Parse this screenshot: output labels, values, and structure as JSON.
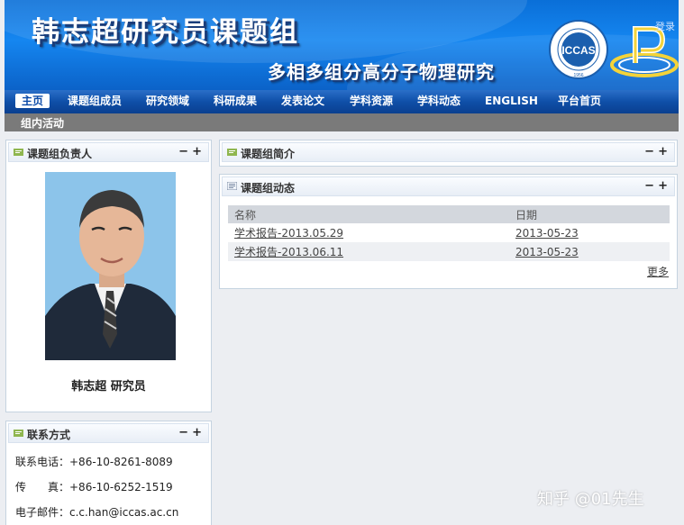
{
  "banner": {
    "title": "韩志超研究员课题组",
    "subtitle": "多相多组分高分子物理研究",
    "login": "登录",
    "seal_text": "ICCAS",
    "seal_year": "1956"
  },
  "nav": {
    "items": [
      {
        "label": "主页",
        "active": true
      },
      {
        "label": "课题组成员"
      },
      {
        "label": "研究领域"
      },
      {
        "label": "科研成果"
      },
      {
        "label": "发表论文"
      },
      {
        "label": "学科资源"
      },
      {
        "label": "学科动态"
      },
      {
        "label": "ENGLISH"
      },
      {
        "label": "平台首页"
      }
    ],
    "second_row": "组内活动"
  },
  "leader_panel": {
    "title": "课题组负责人",
    "name": "韩志超  研究员"
  },
  "contact_panel": {
    "title": "联系方式",
    "lines": [
      "联系电话：+86-10-8261-8089",
      "传　　真：+86-10-6252-1519",
      "电子邮件：c.c.han@iccas.ac.cn"
    ]
  },
  "intro_panel": {
    "title": "课题组简介"
  },
  "news_panel": {
    "title": "课题组动态",
    "columns": [
      "名称",
      "日期"
    ],
    "rows": [
      {
        "name": "学术报告-2013.05.29",
        "date": "2013-05-23"
      },
      {
        "name": "学术报告-2013.06.11",
        "date": "2013-05-23"
      }
    ],
    "more": "更多"
  },
  "controls": {
    "collapse": "−",
    "expand": "+"
  },
  "watermark": "知乎 @01先生",
  "colors": {
    "banner_blue": "#0a6fd8",
    "nav_blue": "#0f4fa8",
    "nav_gray": "#7a7a7a"
  }
}
